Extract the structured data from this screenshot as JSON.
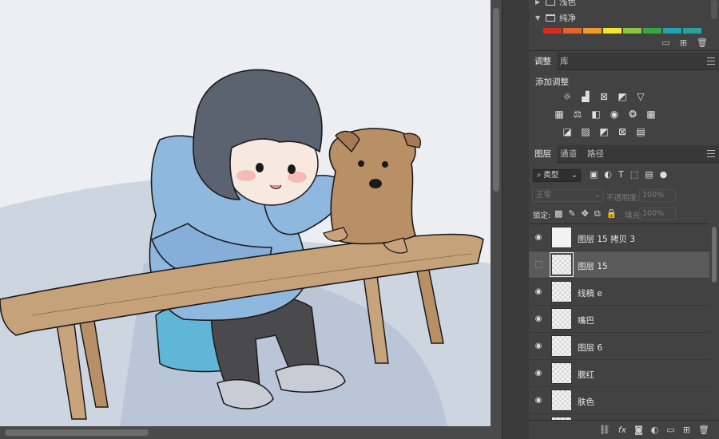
{
  "swatches": {
    "groups": [
      {
        "name": "浅色",
        "expanded": false
      },
      {
        "name": "纯净",
        "expanded": true
      }
    ],
    "colors": [
      "#e02a20",
      "#e8632a",
      "#f39a22",
      "#f4e62b",
      "#8cc63f",
      "#36a84a",
      "#1ba6b3",
      "#27a29b"
    ]
  },
  "adjust_panel": {
    "tabs": [
      "调整",
      "库"
    ],
    "active_tab": "调整",
    "title": "添加调整",
    "icon_rows": [
      [
        "brightness-contrast-icon",
        "levels-icon",
        "curves-icon",
        "exposure-icon",
        "vibrance-icon"
      ],
      [
        "hue-saturation-icon",
        "color-balance-icon",
        "black-white-icon",
        "photo-filter-icon",
        "channel-mixer-icon",
        "color-lookup-icon"
      ],
      [
        "invert-icon",
        "posterize-icon",
        "threshold-icon",
        "selective-color-icon",
        "gradient-map-icon"
      ]
    ]
  },
  "layers_panel": {
    "tabs": [
      "图层",
      "通道",
      "路径"
    ],
    "active_tab": "图层",
    "filter_type": "类型",
    "blend_mode": "正常",
    "opacity_label": "不透明度:",
    "opacity_value": "100%",
    "lock_label": "锁定:",
    "fill_label": "填充:",
    "fill_value": "100%",
    "layers": [
      {
        "name": "图层 15 拷贝 3",
        "visible": true,
        "selected": false,
        "thumb": "solid"
      },
      {
        "name": "图层 15",
        "visible": false,
        "selected": true,
        "thumb": "transparent"
      },
      {
        "name": "线稿 e",
        "visible": true,
        "selected": false,
        "thumb": "transparent"
      },
      {
        "name": "嘴巴",
        "visible": true,
        "selected": false,
        "thumb": "transparent"
      },
      {
        "name": "图层 6",
        "visible": true,
        "selected": false,
        "thumb": "transparent"
      },
      {
        "name": "腮红",
        "visible": true,
        "selected": false,
        "thumb": "transparent"
      },
      {
        "name": "肤色",
        "visible": true,
        "selected": false,
        "thumb": "transparent"
      },
      {
        "name": "",
        "visible": false,
        "selected": false,
        "thumb": "transparent"
      }
    ]
  },
  "bottom_tools": [
    "link-layers-icon",
    "fx-icon",
    "layer-mask-icon",
    "adjustment-layer-icon",
    "new-group-icon",
    "new-layer-icon",
    "delete-layer-icon"
  ],
  "colors": {
    "panel_bg": "#424242",
    "selected_row": "#5a5a5a",
    "jacket": "#8fb8df",
    "dog": "#b98f66",
    "wood": "#c6a27a"
  }
}
